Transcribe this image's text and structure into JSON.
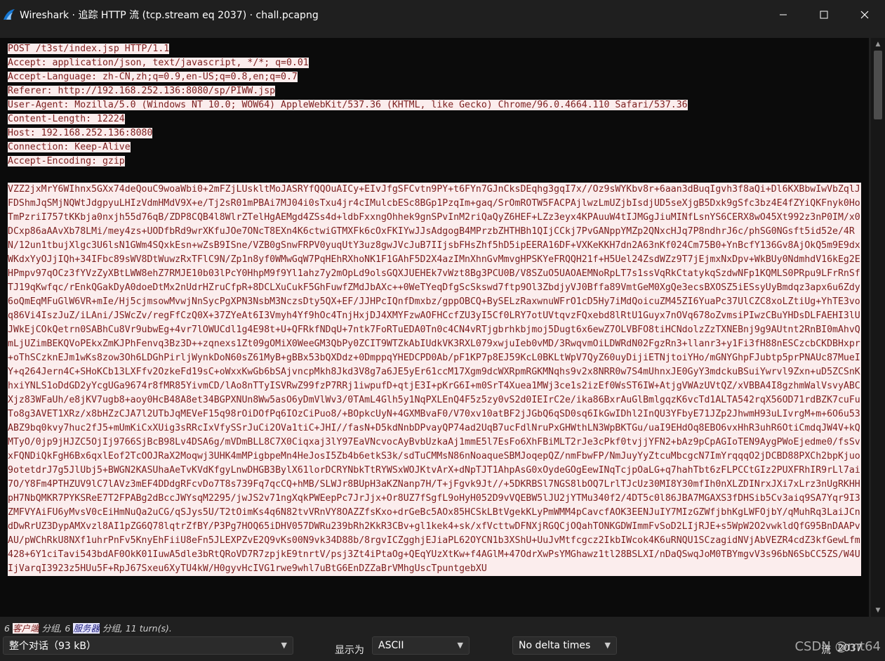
{
  "window": {
    "title": "Wireshark · 追踪 HTTP 流 (tcp.stream eq 2037) · chall.pcapng",
    "controls": [
      "minimize-icon",
      "maximize-icon",
      "close-icon"
    ]
  },
  "colors": {
    "client_bg": "#fbeded",
    "client_fg": "#7c1e1e",
    "server_bg": "#e6e6ff",
    "server_fg": "#1e1e7c",
    "viewer_bg": "#0b0b0b"
  },
  "request_headers": [
    "POST /t3st/index.jsp HTTP/1.1",
    "Accept: application/json, text/javascript, */*; q=0.01",
    "Accept-Language: zh-CN,zh;q=0.9,en-US;q=0.8,en;q=0.7",
    "Referer: http://192.168.252.136:8080/sp/PIWW.jsp",
    "User-Agent: Mozilla/5.0 (Windows NT 10.0; WOW64) AppleWebKit/537.36 (KHTML, like Gecko) Chrome/96.0.4664.110 Safari/537.36",
    "Content-Length: 12224",
    "Host: 192.168.252.136:8080",
    "Connection: Keep-Alive",
    "Accept-Encoding: gzip"
  ],
  "request_body": "VZZ2jxMrY6WIhnx5GXx74deQouC9woaWbi0+2mFZjLUskltMoJASRYfQQOuAICy+EIvJfgSFCvtn9PY+t6FYn7GJnCksDEqhg3gqI7x//Oz9sWYKbv8r+6aan3dBuqIgvh3f8aQi+Dl6KXBbwIwVbZqlJFDShmJqSMjNQWtJdgpyuLHIzVdmHMdV9X+e/Tj2sR01mPBAi7MJ04i0sTxu4jr4cIMulcbESc8BGp1PzqIm+gaq/SrOmROTW5FACPAjlwzLmUZjbIsdjUD5seXjgB5Dxk9gSfc3bz4E4fZYiQKFnyk0HoTmPzriI757tKKbja0nxjh55d76qB/ZDP8CQB4l8WlrZTelHgAEMgd4ZSs4d+ldbFxxngOhhek9gnSPvInM2riQaQyZ6HEF+LZz3eyx4KPAuuW4tIJMGgJiuMINfLsnYS6CERX8wO45Xt992z3nP0IM/x0DCxp86aAAvXb78LMi/mey4zs+UODfbRd9wrXKfuJOe7ONcT8EXn4K6ctwiGTMXFk6cOxFKIYwJJsAdgogB4MPrzbZHTHBh1QIjCCkj7PvGANppYMZp2QNxcHJq7P8ndhrJ6c/phSG0NGsft5id52e/4RN/12un1tbujXlgc3U6lsN1GWm4SQxkEsn+wZsB9ISne/VZB0gSnwFRPV0yuqUtY3uz8gwJVcJuB7IIjsbFHsZhf5hD5ipEERA16DF+VXKeKKH7dn2A63nKf024Cm75B0+YnBcfY136Gv8AjOkQ5m9E9dxWKdxYyOJjIQh+34IFbc89sWV8DtWuwzRxTFlC9N/Zp1n8yf0WMwGqW7PqHEhRXhoNK1F1GAhF5D2X4azIMnXhnGvMmvgHPSKYeFRQQH21f+H5Uel24ZsdWZz9T7jEjmxNxDpv+WkBUy0NdmhdV16kEg2EHPmpv97qOCz3fYVzZyXBtLWW8ehZ7RMJE10b03lPcY0HhpM9f9Yl1ahz7y2mOpLd9olsGQXJUEHEk7vWzt8Bg3PCU0B/V8SZuO5UAOAEMNoRpLT7s1ssVqRkCtatykqSzdwNFp1KQMLS0PRpu9LFrRnSfTJ19qKwfqc/rEnkQGakDyA0doeDtMx2nUdrHZruCfpR+8DCLXuCukF5GhFuwfZMdJbAXc++0WeTYeqDfgScSkswd7ftp9Ol3ZbdjyVJ0Bffa89VmtGeM0XgQe3ecsBXOSZ5iESsyUyBmdqz3apx6u6Zdy6oQmEqMFuGlW6VR+mIe/Hj5cjmsowMvwjNnSycPgXPN3NsbM3NczsDty5QX+EF/JJHPcIQnfDmxbz/gppOBCQ+BySELzRaxwnuWFrO1cD5Hy7iMdQoicuZM45ZI6YuaPc37UlCZC8xoLZtiUg+YhTE3voq86Vi4IszJuZ/iLAni/JSWcZv/regFfCzQ0X+37ZYeAt6I3Vmyh4Yf9hOc4TnjHxjDJ4XMYFzwAOFHCcfZU3yI5Cf0LRY7otUVtqvzFQxebd8lRtU1Guyx7nOVq678oZvmsiPIwzCBuYHDsDLFAEHI3lUJWkEjCOkQetrn0SABhCu8Vr9ubwEg+4vr7lOWUCdl1g4E98t+U+QFRkfNDqU+7ntk7FoRTuEDA0Tn0c4CN4vRTjgbrhkbjmoj5Dugt6x6ewZ7OLVBFO8tiHCNdolzZzTXNEBnj9g9AUtnt2RnBI0mAhvQmLjUZimBEKQVoPEkxZmKJPhFenvq3Bz3D++zqnexs1Zt09gOMiX0WeeGM3QbPy0ZCIT9WTZkAbIUdkVK3RXL079xwjuIeb0vMD/3RwqvmOiLDWRdN02FgzRn3+llanr3+y1Fi3fH88nESCzcbCKDBHxpr+oThSCzknEJm1wKs8zow3Oh6LDGhPirljWynkDoN60sZ61MyB+gBBx53bQXDdz+0DmppqYHEDCPD0Ab/pF1KP7p8EJ59KcL0BKLtWpV7QyZ60uyDijiETNjtoiYHo/mGNYGhpFJubtp5prPNAUc87MueIY+q264Jern4C+SHoKCb13LXFfv2OzkeFd19sC+oWxxKwGb6bSAjvncpMkh8Jkd3V8g7a6JE5yEr61ccM17Xgm9dcWXRpmRGKMNqhs9v2x8NRR0w7S4mUhnxJE0GyY3mdckuBSuiYwrvl9Zxn+uD5ZCSnKhxiYNLS1oDdGD2yYcgUGa9674r8fMR85YivmCD/lAo8nTTyISVRwZ99fzP7RRj1iwpufD+qtjE3I+pKrG6I+m0SrT4Xuea1MWj3ce1s2izEf0WsST6IW+AtjgVWAzUVtQZ/xVBBA4I8gzhmWalVsvyABCXjz83WFaUh/e8jKV7ugb8+aoy0HcB48A8et34BGPXNUn8Ww5asO6yDmVlWv3/0TAmL4Glh5y1NqPXLEnQ4F5z5zy0vS2d0IEIrC2e/ika86BxrAuGlBmlgqzK6vcTd1ALTA542rqX56OD71rdBZK7cuFuTo8g3AVET1XRz/x8bHZzCJA7l2UTbJqMEVeF15q98rOiDOfPq6IOzCiPuo8/+BOpkcUyN+4GXMBvaF0/V70xv10atBF2jJGbQ6qSD0sq6IkGwIDhl2InQU3YFbyE71JZp2JhwmH93uLIvrgM+m+6O6u53ABZ9bq0kvy7huc2fJ5+mUmKiCxXUig3sRRcIxVfySSrJuCi2OVa1tiC+JHI//fasN+D5kdNnbDPvayQP74ad2UqB7ucFdlNruPxGHWthLN3WpBKTGu/uaI9EHdOq8EBO6vxHhR3uhR6OtiCmdqJW4V+kQMTyO/0jp9jHJZC5OjIj9766SjBcB98Lv4DSA6g/mVDmBLL8C7X0Ciqxaj3lY97EaVNcvocAyBvbUzkaAj1mmE5l7EsFo6XhFBiMLT2rJe3cPkf0tvjjYFN2+bAz9pCpAGIoTEN9AygPWoEjedme0/fsSvxFQNDiQkFgH6Bx6qxlEof2TcOOJRaX2Moqwj3UHK4mMPigbpeMn4HeJosI5Zb4b6etkS3k/sdTuCMMsN86nNoaqueSBMJoqepQZ/nmFbwFP/NmJuyYyZtcuMbcgcN7ImYrqqqO2jDCBD88PXCh2bpKjuo9otetdrJ7g5JlUbj5+BWGN2KASUhaAeTvKVdKfgyLnwDHGB3BylX61lorDCRYNbkTtRYWSxWOJKtvArX+dNpTJT1AhpAsG0xOydeGOgEewINqTcjpOaLG+q7hahTbt6zFLPCCtGIz2PUXFRhIR9rLl7ai7O/Y8Fm4PTHZUV9lC7lAVz3mEF4DDdgRFcvDo7T8s739Fq7qcCQ+hMB/SLWJr8BUpH3aKZNanp7H/T+jFgvk9Jt//+5DKRBSl7NGS8lbOQ7LrlTJcUz30MI8Y30mfIh0nXLZDINrxJXi7xLrz3nUgRKHHpH7NbQMKR7PYKSReE7T2FPABg2dBccJWYsqM2295/jwJS2v71ngXqkPWEepPc7JrJjx+Or8UZ7fSgfL9oHyH052D9vVQEBW5lJU2jYTMu340f2/4DT5c0l86JBA7MGAXS3fDHSib5Cv3aiq9SA7Yqr9I3ZMFVYAiFU6yMvsV0cEiHmNuQa2uCG/qSJys5U/T2tOimKs4q6N82tvVRnVY8OAZZfsKxo+drGeBc5AOx85HCSkLBtVgekKLyPmWMM4pCavcfAOK3EENJuIY7MIzGZWfjbhKgLWFOjbY/qMuhRq3LaiJCndDwRrUZ3DypAMXvzl8AI1pZG6Q78lqtrZfBY/P3Pg7HOQ65iDHV057DWRu239bRh2KkR3CBv+gl1kek4+sk/xfVcttwDFNXjRGQCjOQahTONKGDWImmFvSoD2LIjRJE+s5WpW2O2vwkldQfG95BnDAAPvAU/pWChRkU8NXf1uhrPnFv5KnyEhFiiU8eFn5JLEXPZvE2Q9vKs00N9vk34D88b/8rgvICZgghjEJiaPL62OYCN1b3XShU+UuJvMtfcgcz2IkbIWcok4K6uRNQU1SCzagidNVjAbVEZR4cdZ3kfGewLfm428+6Y1ciTavi543bdAF0OkK01IuwA5dle3bRtQRoVD7R7zpjkE9tnrtV/psj3Zt4iPtaOg+QEqYUzXtKw+f4AGlM+47OdrXwPsYMGhawz1tl28BSLXI/nDaQSwqJoM0TBYmgvV3s96bN6SbCC5ZS/W4UIjVarqI3923z5HUu5F+RpJ67Sxeu6XyTU4kW/H0gyvHcIVG1rwe9whl7uBtG6EnDZZaBrVMhgUscTpuntgebXU",
  "summary": {
    "client_count": "6",
    "client_label": "客户端",
    "client_suffix": "分组,",
    "server_count": "6",
    "server_label": "服务器",
    "server_suffix": "分组,",
    "turns": "11 turn(s)."
  },
  "bottom": {
    "conversation_select": "整个对话（93 kB）",
    "show_as_label": "显示为",
    "show_as_select": "ASCII",
    "delta_select": "No delta times",
    "stream_label": "流",
    "stream_value": "2037"
  },
  "watermark": "CSDN @mt64"
}
